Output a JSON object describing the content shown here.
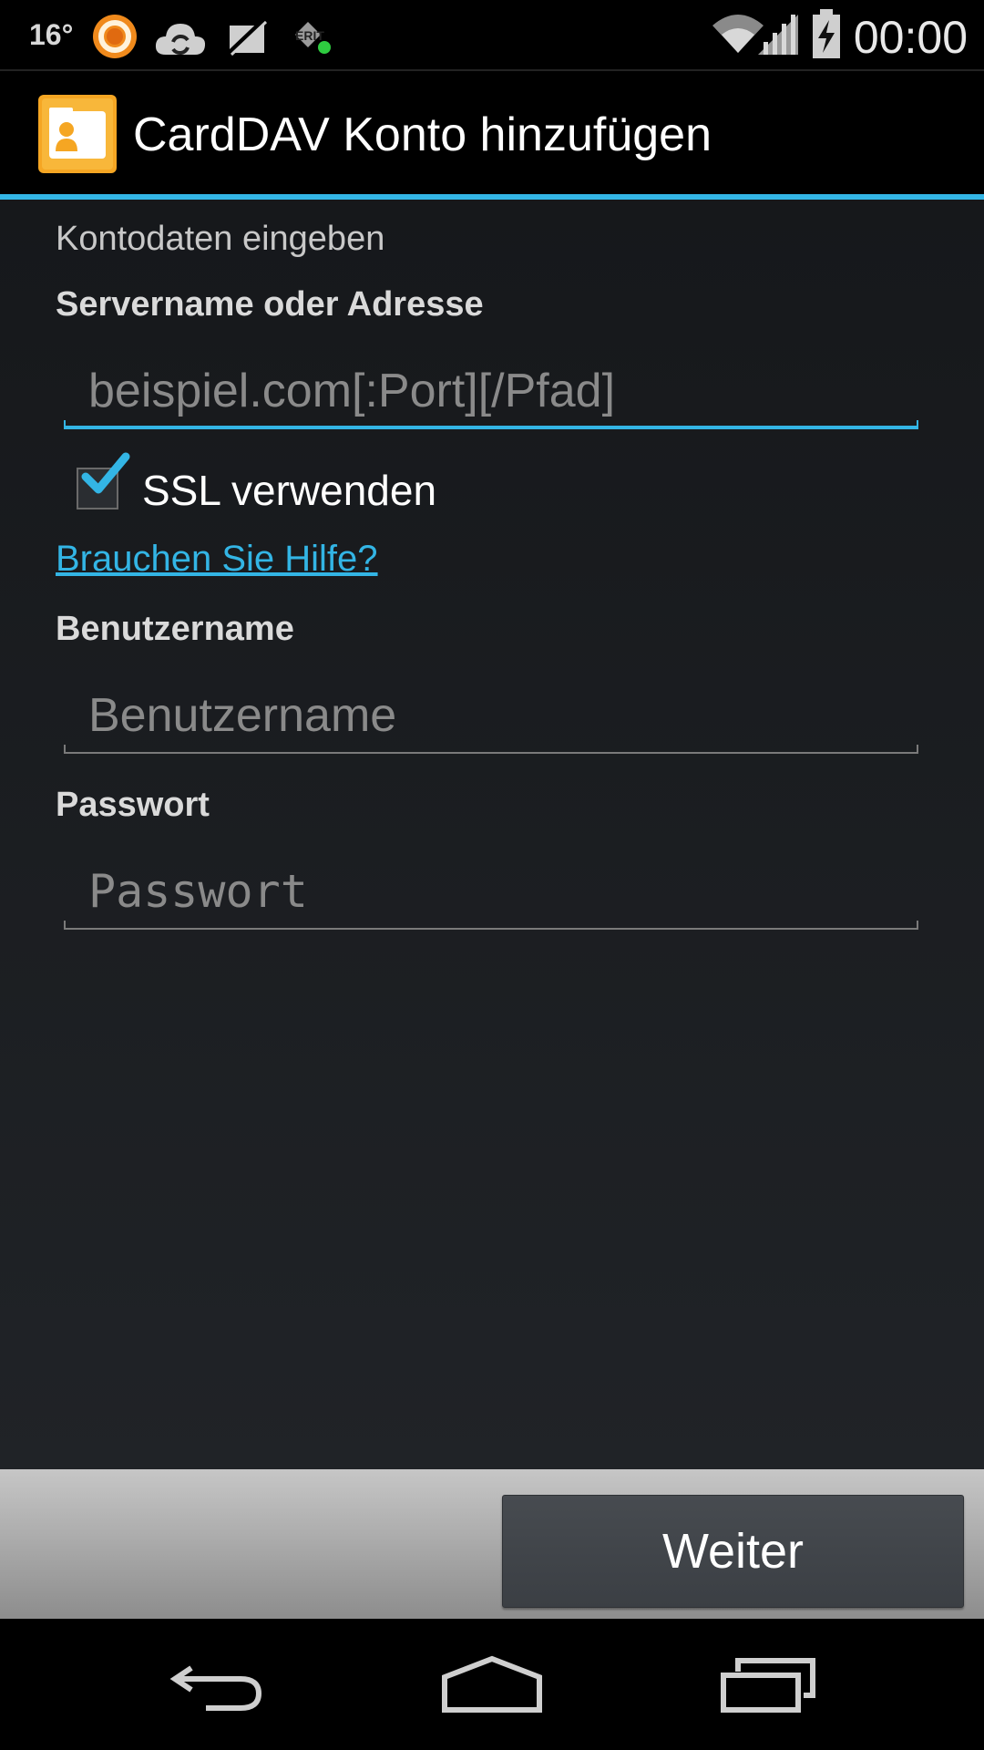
{
  "status_bar": {
    "temperature": "16°",
    "time": "00:00",
    "icons": [
      "avg-ring-icon",
      "cloud-sync-icon",
      "no-sync-icon",
      "erit-network-icon",
      "wifi-icon",
      "signal-icon",
      "battery-charging-icon"
    ]
  },
  "action_bar": {
    "icon": "contacts-folder-icon",
    "title": "CardDAV Konto hinzufügen"
  },
  "form": {
    "heading": "Kontodaten eingeben",
    "server_label": "Servername oder Adresse",
    "server_placeholder": "beispiel.com[:Port][/Pfad]",
    "server_value": "",
    "ssl_label": "SSL verwenden",
    "ssl_checked": true,
    "help_link": "Brauchen Sie Hilfe?",
    "username_label": "Benutzername",
    "username_placeholder": "Benutzername",
    "username_value": "",
    "password_label": "Passwort",
    "password_placeholder": "Passwort",
    "password_value": ""
  },
  "button_bar": {
    "next_label": "Weiter"
  },
  "nav_bar": {
    "buttons": [
      "back-icon",
      "home-icon",
      "recents-icon"
    ]
  },
  "colors": {
    "accent": "#33b5e5",
    "app_icon": "#f5a623"
  }
}
